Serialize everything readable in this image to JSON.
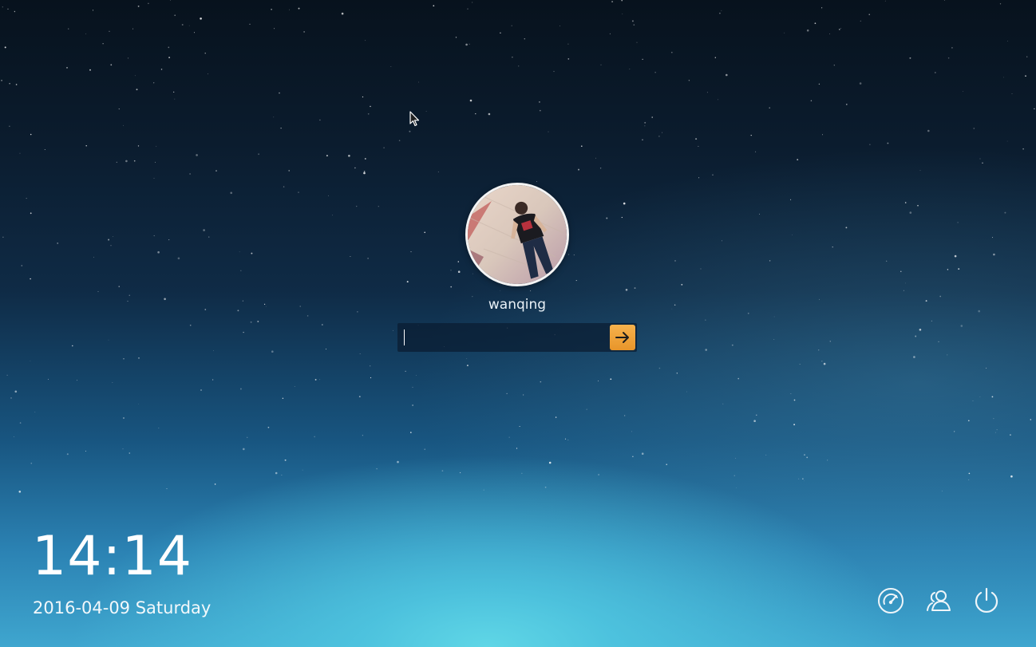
{
  "user": {
    "name": "wanqing",
    "avatar_icon": "user-avatar-photo"
  },
  "login": {
    "password_value": "",
    "password_placeholder": "",
    "submit_icon": "arrow-right-icon",
    "accent_color": "#f0a23a"
  },
  "clock": {
    "time": "14:14",
    "date": "2016-04-09 Saturday"
  },
  "system_buttons": [
    {
      "name": "dashboard-icon"
    },
    {
      "name": "switch-user-icon"
    },
    {
      "name": "power-icon"
    }
  ]
}
